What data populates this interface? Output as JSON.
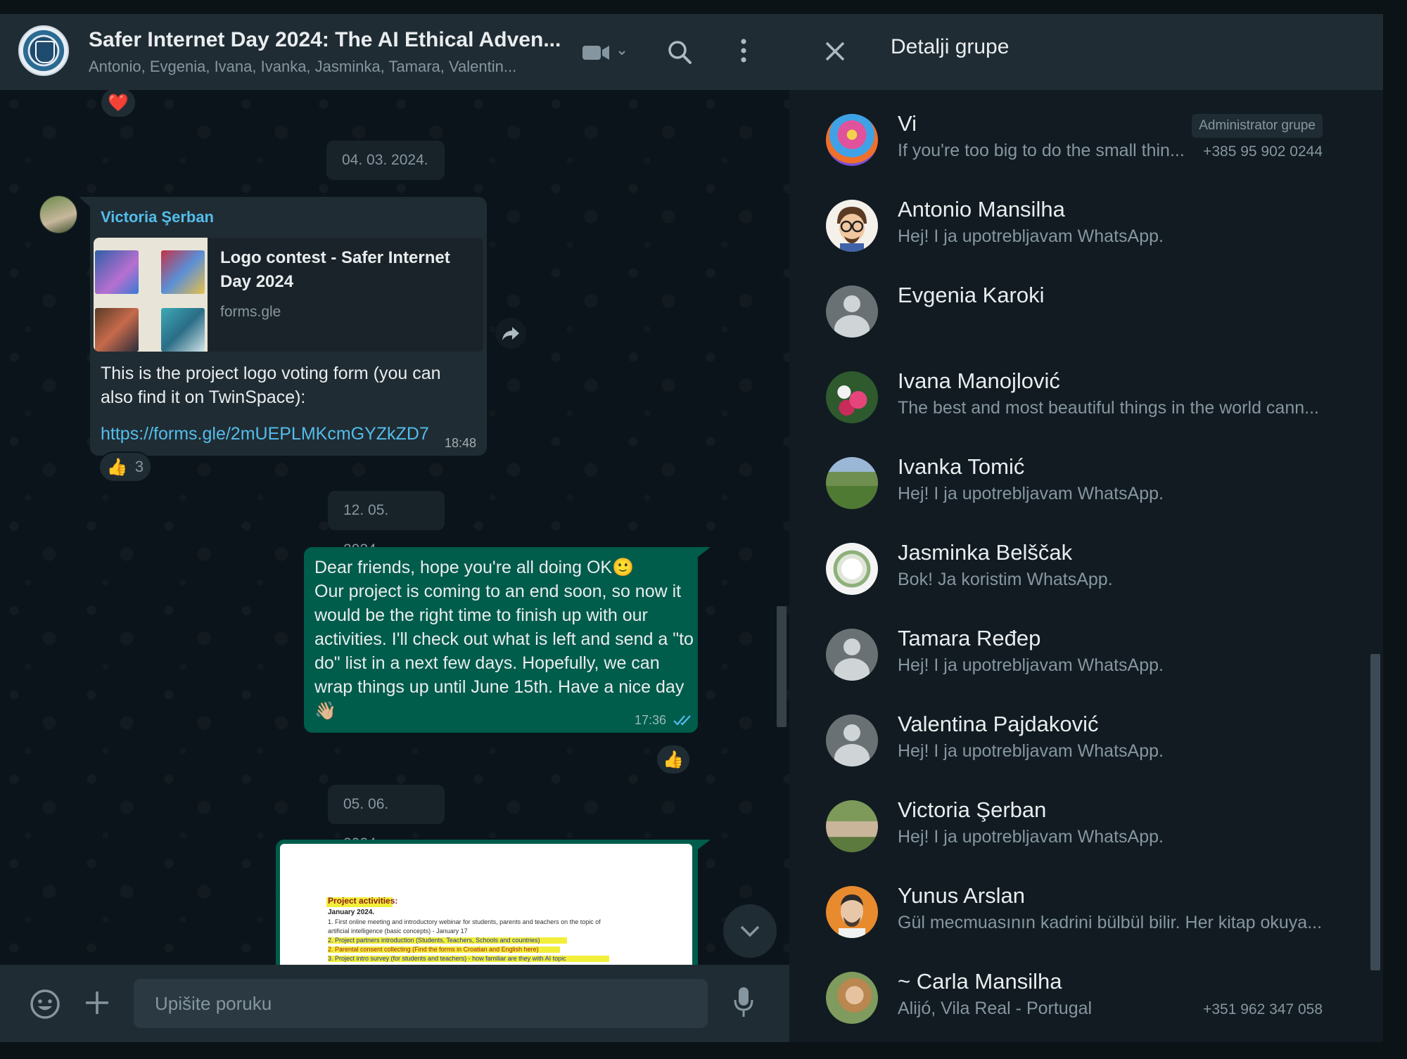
{
  "chat": {
    "header": {
      "title": "Safer Internet Day 2024: The AI Ethical Adven...",
      "participants": "Antonio, Evgenia, Ivana, Ivanka, Jasminka, Tamara, Valentin..."
    },
    "messages": {
      "top_reaction": "❤️",
      "date1": "04. 03. 2024.",
      "msg1_sender": "Victoria Şerban",
      "link_title": "Logo contest - Safer Internet Day 2024",
      "link_domain": "forms.gle",
      "msg1_text": "This is the project logo voting form (you can also find it on TwinSpace):",
      "msg1_link": "https://forms.gle/2mUEPLMKcmGYZkZD7",
      "msg1_time": "18:48",
      "msg1_reaction_emoji": "👍",
      "msg1_reaction_count": "3",
      "date2": "12. 05. 2024.",
      "msg2_line1": "Dear friends, hope you're all doing OK🙂",
      "msg2_body": "Our project is coming to an end soon, so now it would be the right time to finish up with our activities. I'll check out what is left and send a \"to do\" list in a next few days. Hopefully, we can wrap things up until June 15th. Have a nice day 👋🏼",
      "msg2_time": "17:36",
      "msg2_reaction": "👍",
      "date3": "05. 06. 2024.",
      "doc_heading": "Project activities:",
      "doc_subheading": "January 2024.",
      "doc_line1": "1. First online meeting and introductory webinar for students, parents and teachers on the topic of",
      "doc_line2": "artificial intelligence (basic concepts) - January 17",
      "doc_line3": "2. Project partners introduction (Students, Teachers, Schools and countries)",
      "doc_line4": "2. Parental consent collecting (Find the forms in Croatian and English here)",
      "doc_line5": "3. Project intro survey (for students and teachers) - how familiar are they with AI topic"
    },
    "input": {
      "placeholder": "Upišite poruku"
    }
  },
  "details": {
    "title": "Detalji grupe",
    "members": [
      {
        "name": "Vi",
        "status": "If you're too big to do the small thin...",
        "phone": "+385 95 902 0244",
        "badge": "Administrator grupe"
      },
      {
        "name": "Antonio Mansilha",
        "status": "Hej! I ja upotrebljavam WhatsApp."
      },
      {
        "name": "Evgenia Karoki",
        "status": ""
      },
      {
        "name": "Ivana Manojlović",
        "status": "The best and most beautiful things in the world cann..."
      },
      {
        "name": "Ivanka Tomić",
        "status": "Hej! I ja upotrebljavam WhatsApp."
      },
      {
        "name": "Jasminka Belščak",
        "status": "Bok! Ja koristim WhatsApp."
      },
      {
        "name": "Tamara Ređep",
        "status": "Hej! I ja upotrebljavam WhatsApp."
      },
      {
        "name": "Valentina Pajdaković",
        "status": "Hej! I ja upotrebljavam WhatsApp."
      },
      {
        "name": "Victoria Şerban",
        "status": "Hej! I ja upotrebljavam WhatsApp."
      },
      {
        "name": "Yunus Arslan",
        "status": "Gül mecmuasının kadrini bülbül bilir. Her kitap okuya..."
      },
      {
        "name": "~ Carla Mansilha",
        "status": "Alijó, Vila Real - Portugal",
        "phone": "+351 962 347 058"
      }
    ]
  },
  "colors": {
    "panel": "#202c33",
    "background": "#111b21",
    "outgoing_bubble": "#005c4b",
    "link": "#53bdeb",
    "read_ticks": "#53bdeb"
  },
  "icons": [
    "group-avatar",
    "video-call-icon",
    "search-icon",
    "menu-icon",
    "close-icon",
    "forward-icon",
    "emoji-icon",
    "attach-plus-icon",
    "microphone-icon",
    "scroll-down-icon",
    "double-check-icon"
  ]
}
